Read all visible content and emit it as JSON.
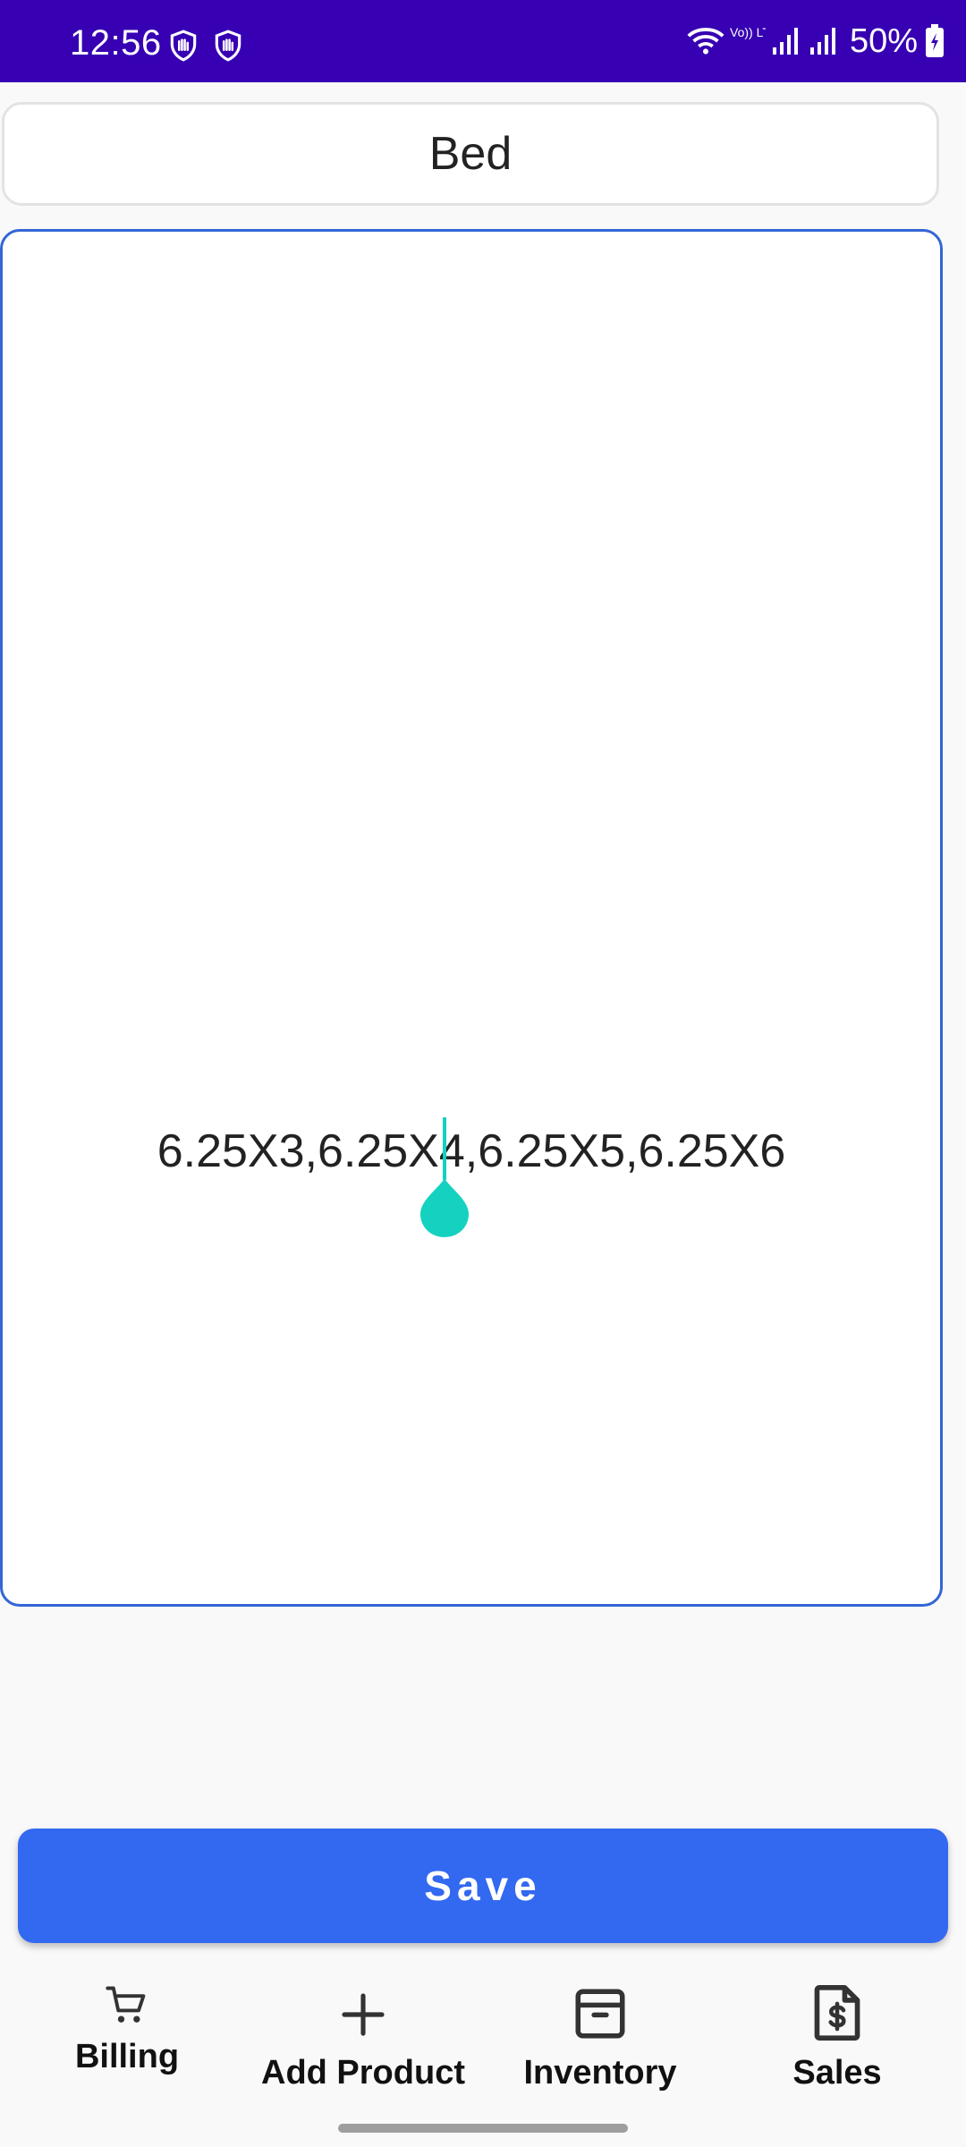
{
  "status_bar": {
    "time": "12:56",
    "network_label": "Vo)) LTE1",
    "battery": "50%"
  },
  "form": {
    "product_name": "Bed",
    "sizes_text": "6.25X3,6.25X4,6.25X5,6.25X6",
    "save_label": "Save"
  },
  "bottom_nav": {
    "items": [
      {
        "label": "Billing",
        "icon": "cart-icon"
      },
      {
        "label": "Add Product",
        "icon": "plus-icon"
      },
      {
        "label": "Inventory",
        "icon": "archive-box-icon"
      },
      {
        "label": "Sales",
        "icon": "dollar-document-icon"
      }
    ]
  },
  "colors": {
    "status_bar": "#3700b3",
    "accent": "#3369f0",
    "field_focus_border": "#3366d6",
    "caret": "#14d2bf"
  }
}
